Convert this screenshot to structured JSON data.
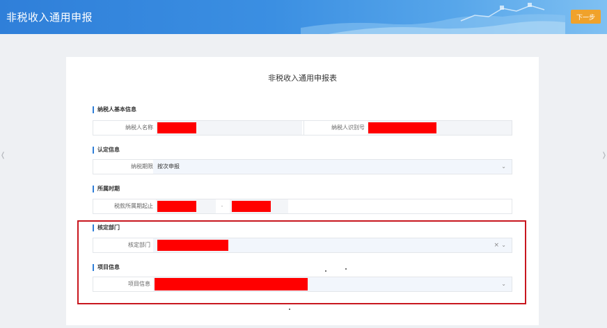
{
  "header": {
    "title": "非税收入通用申报",
    "next_label": "下一步"
  },
  "form": {
    "title": "非税收入通用申报表"
  },
  "taxpayer_info": {
    "section": "纳税人基本信息",
    "name_label": "纳税人名称",
    "id_label": "纳税人识别号"
  },
  "recognition": {
    "section": "认定信息",
    "period_label": "纳税期限",
    "period_value": "按次申报"
  },
  "period": {
    "section": "所属时期",
    "range_label": "税款所属期起止",
    "separator": "-"
  },
  "dept": {
    "section": "核定部门",
    "label": "核定部门"
  },
  "project": {
    "section": "项目信息",
    "label": "项目信息"
  },
  "colors": {
    "header": "#3b8fe2",
    "accent": "#f0a22b",
    "highlight": "#c8161e",
    "redaction": "#ff0000"
  },
  "icons": [
    "chevron-down-icon",
    "clear-icon",
    "chevron-left-icon",
    "chevron-right-icon"
  ]
}
